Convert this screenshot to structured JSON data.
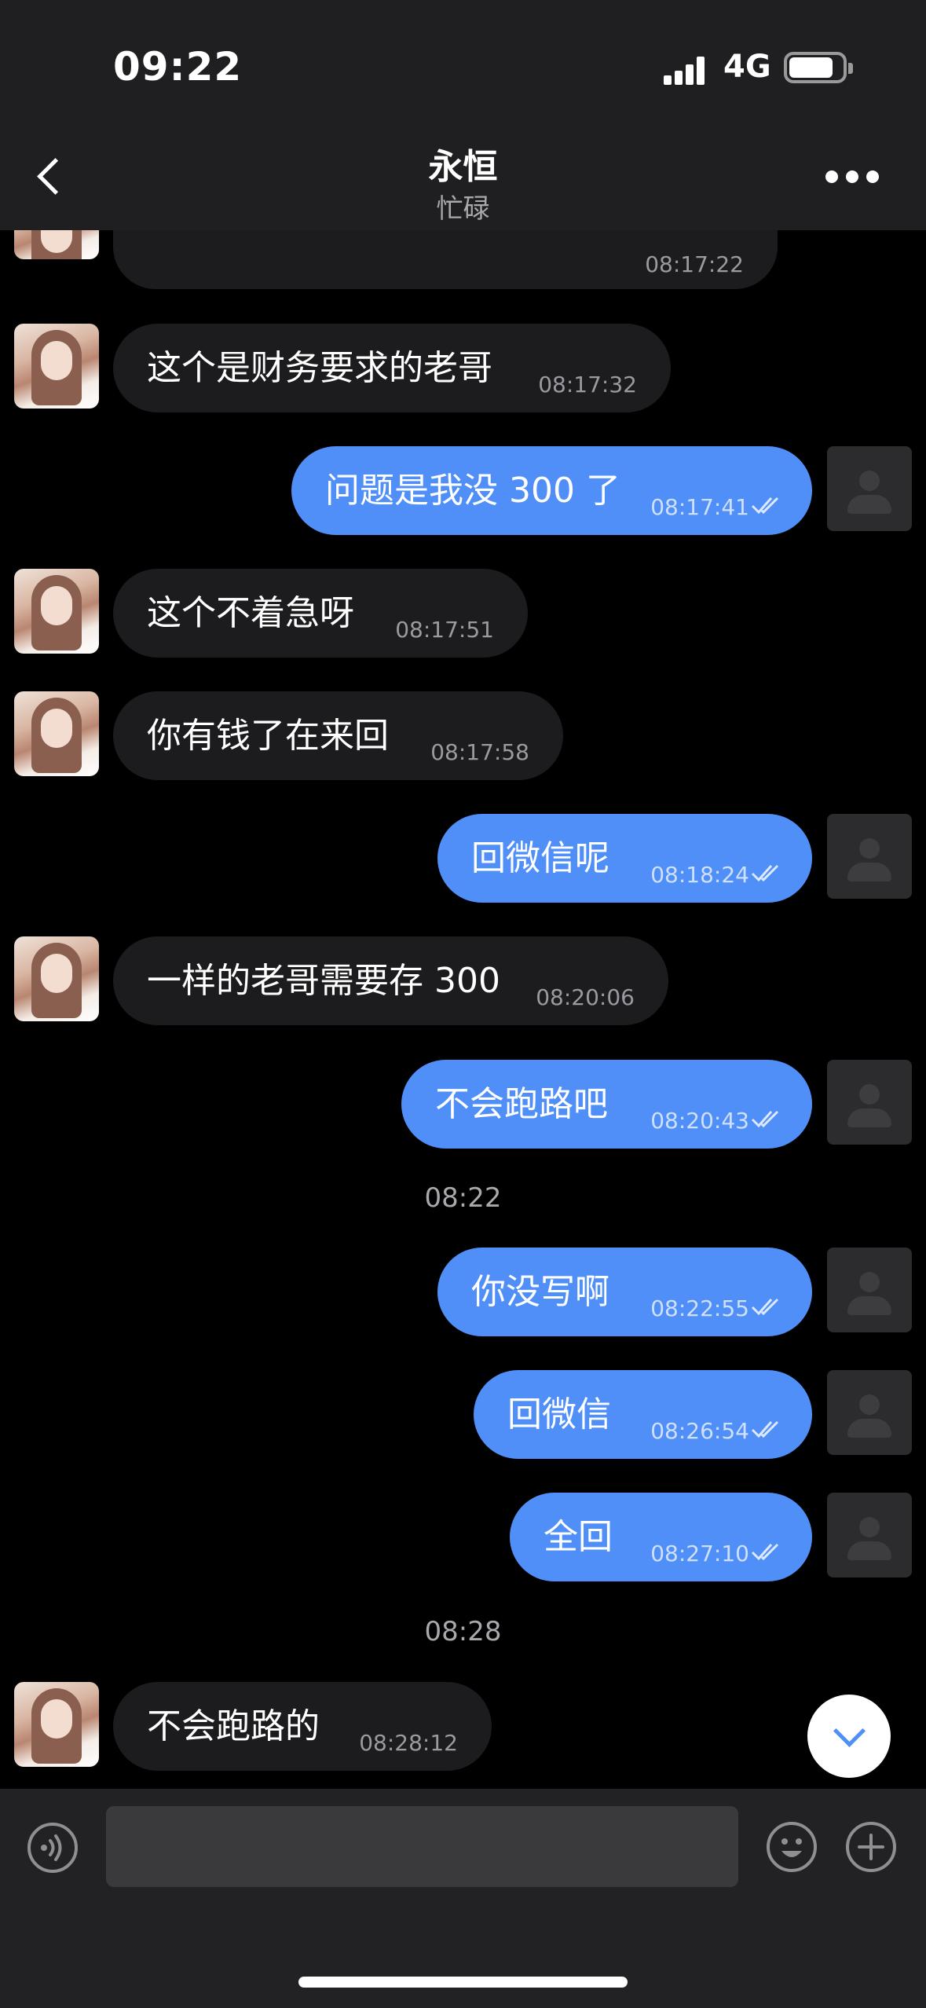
{
  "status_bar": {
    "time": "09:22",
    "network": "4G",
    "battery_level": 0.85
  },
  "header": {
    "title": "永恒",
    "subtitle": "忙碌"
  },
  "messages": [
    {
      "direction": "in",
      "text": "",
      "time": "08:17:22",
      "partial": true
    },
    {
      "direction": "in",
      "text": "这个是财务要求的老哥",
      "time": "08:17:32"
    },
    {
      "direction": "out",
      "text": "问题是我没 300 了",
      "time": "08:17:41",
      "read": true
    },
    {
      "direction": "in",
      "text": "这个不着急呀",
      "time": "08:17:51"
    },
    {
      "direction": "in",
      "text": "你有钱了在来回",
      "time": "08:17:58"
    },
    {
      "direction": "out",
      "text": "回微信呢",
      "time": "08:18:24",
      "read": true
    },
    {
      "direction": "in",
      "text": "一样的老哥需要存 300",
      "time": "08:20:06"
    },
    {
      "direction": "out",
      "text": "不会跑路吧",
      "time": "08:20:43",
      "read": true
    },
    {
      "separator": "08:22"
    },
    {
      "direction": "out",
      "text": "你没写啊",
      "time": "08:22:55",
      "read": true
    },
    {
      "direction": "out",
      "text": "回微信",
      "time": "08:26:54",
      "read": true
    },
    {
      "direction": "out",
      "text": "全回",
      "time": "08:27:10",
      "read": true
    },
    {
      "separator": "08:28"
    },
    {
      "direction": "in",
      "text": "不会跑路的",
      "time": "08:28:12"
    }
  ],
  "composer": {
    "input_value": "",
    "input_placeholder": ""
  },
  "icons": {
    "back": "chevron-left-icon",
    "more": "more-dots-icon",
    "scroll": "chevron-down-icon",
    "voice": "voice-icon",
    "emoji": "emoji-icon",
    "plus": "plus-icon",
    "read_receipt": "double-check-icon"
  },
  "colors": {
    "outgoing_bubble": "#4f8ff7",
    "incoming_bubble": "#1c1c1e",
    "background": "#000000",
    "header": "#1f1f21"
  }
}
